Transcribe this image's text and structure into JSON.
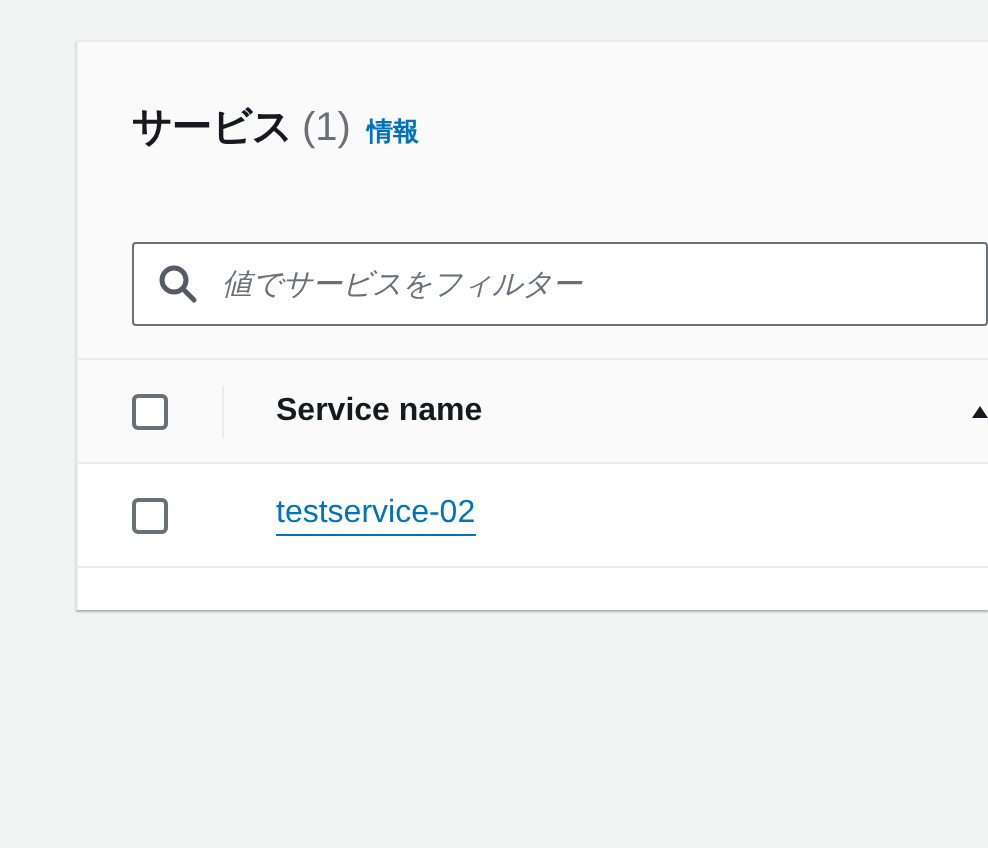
{
  "panel": {
    "title": "サービス",
    "count": "(1)",
    "info_link": "情報"
  },
  "search": {
    "placeholder": "値でサービスをフィルター"
  },
  "table": {
    "header_checked": false,
    "columns": [
      "Service name"
    ],
    "rows": [
      {
        "checked": false,
        "service_name": "testservice-02"
      }
    ]
  }
}
